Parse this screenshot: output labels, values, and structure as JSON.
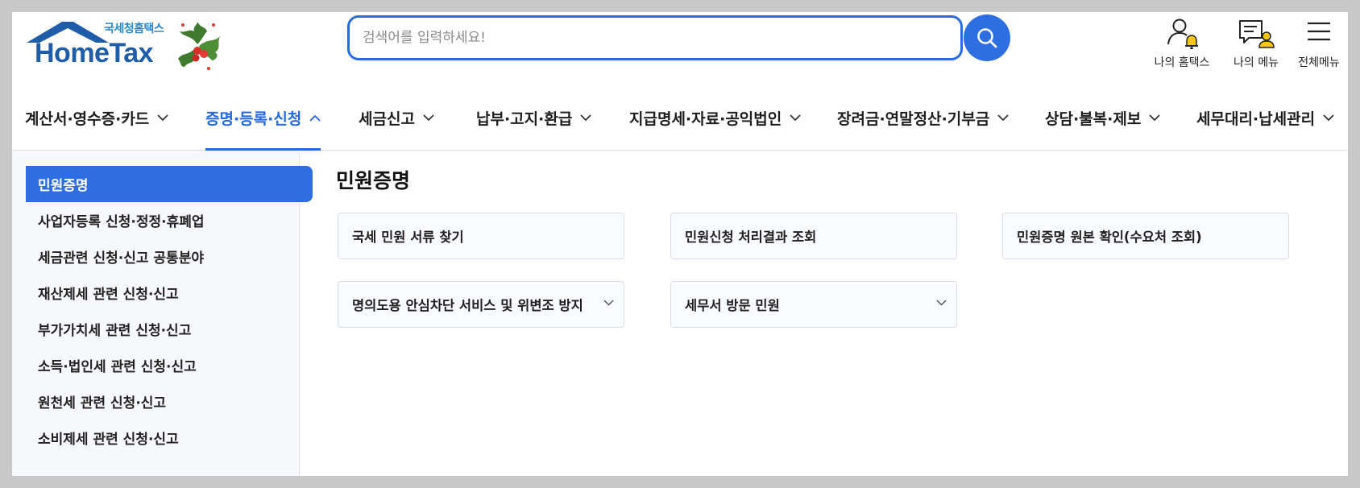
{
  "brand": {
    "sub": "국세청홈택스",
    "name": "HomeTax",
    "color": "#1f5da8"
  },
  "search": {
    "placeholder": "검색어를 입력하세요!",
    "value": ""
  },
  "utility": [
    {
      "label": "나의 홈택스",
      "icon": "user-bell-icon"
    },
    {
      "label": "나의 메뉴",
      "icon": "user-list-icon"
    },
    {
      "label": "전체메뉴",
      "icon": "hamburger-menu-icon"
    }
  ],
  "gnb": [
    {
      "label": "계산서·영수증·카드",
      "active": false
    },
    {
      "label": "증명·등록·신청",
      "active": true
    },
    {
      "label": "세금신고",
      "active": false
    },
    {
      "label": "납부·고지·환급",
      "active": false
    },
    {
      "label": "지급명세·자료·공익법인",
      "active": false
    },
    {
      "label": "장려금·연말정산·기부금",
      "active": false
    },
    {
      "label": "상담·불복·제보",
      "active": false
    },
    {
      "label": "세무대리·납세관리",
      "active": false
    }
  ],
  "lnb": [
    {
      "label": "민원증명",
      "active": true
    },
    {
      "label": "사업자등록 신청·정정·휴폐업",
      "active": false
    },
    {
      "label": "세금관련 신청·신고 공통분야",
      "active": false
    },
    {
      "label": "재산제세 관련 신청·신고",
      "active": false
    },
    {
      "label": "부가가치세 관련 신청·신고",
      "active": false
    },
    {
      "label": "소득·법인세 관련 신청·신고",
      "active": false
    },
    {
      "label": "원천세 관련 신청·신고",
      "active": false
    },
    {
      "label": "소비제세 관련 신청·신고",
      "active": false
    }
  ],
  "content": {
    "title": "민원증명",
    "cards": [
      {
        "label": "국세 민원 서류 찾기",
        "expandable": false
      },
      {
        "label": "민원신청 처리결과 조회",
        "expandable": false
      },
      {
        "label": "민원증명 원본 확인(수요처 조회)",
        "expandable": false
      },
      {
        "label": "명의도용 안심차단 서비스 및 위변조 방지",
        "expandable": true
      },
      {
        "label": "세무서 방문 민원",
        "expandable": true
      }
    ]
  },
  "colors": {
    "accent": "#2368e0",
    "sidebar_bg": "#f7f8fb",
    "notice_yellow": "#f5c518"
  }
}
